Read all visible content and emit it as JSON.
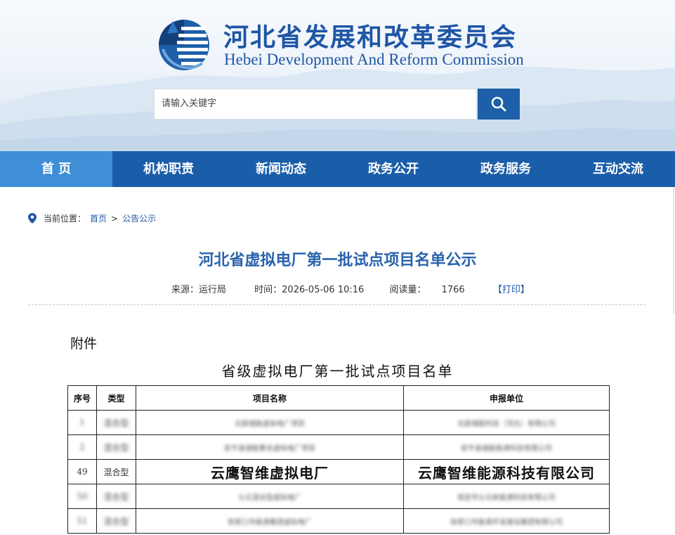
{
  "header": {
    "title_cn": "河北省发展和改革委员会",
    "title_en": "Hebei Development And Reform Commission",
    "search_placeholder": "请输入关键字",
    "brand_color": "#1a5da9"
  },
  "nav": {
    "items": [
      {
        "label": "首 页",
        "active": true
      },
      {
        "label": "机构职责"
      },
      {
        "label": "新闻动态"
      },
      {
        "label": "政务公开"
      },
      {
        "label": "政务服务"
      },
      {
        "label": "互动交流"
      }
    ]
  },
  "breadcrumb": {
    "prefix": "当前位置：",
    "home": "首页",
    "separator": ">",
    "current": "公告公示"
  },
  "article": {
    "title": "河北省虚拟电厂第一批试点项目名单公示",
    "source": "来源：运行局",
    "time": "时间：2026-05-06 10:16",
    "views_label": "阅读量：",
    "views": "1766",
    "print": "【打印】"
  },
  "content": {
    "attachment": "附件",
    "list_title": "省级虚拟电厂第一批试点项目名单",
    "table": {
      "headers": [
        "序号",
        "类型",
        "项目名称",
        "申报单位"
      ],
      "rows": [
        {
          "no": "1",
          "type": "混合型",
          "name": "北辰储能虚拟电厂项目",
          "unit": "北辰储能科技（河北）有限公司",
          "blurred": true
        },
        {
          "no": "2",
          "type": "混合型",
          "name": "安平县储能聚合虚拟电厂项目",
          "unit": "安平县储能能源科技有限公司",
          "blurred": true
        },
        {
          "no": "49",
          "type": "混合型",
          "name": "云鹰智维虚拟电厂",
          "unit": "云鹰智维能源科技有限公司",
          "blurred": false
        },
        {
          "no": "50",
          "type": "混合型",
          "name": "公元混合型虚拟电厂",
          "unit": "保定市公元新能源科技有限公司",
          "blurred": true
        },
        {
          "no": "51",
          "type": "混合型",
          "name": "张家口市能源集团虚拟电厂",
          "unit": "张家口市能源开发建设集团有限公司",
          "blurred": true
        }
      ]
    }
  }
}
